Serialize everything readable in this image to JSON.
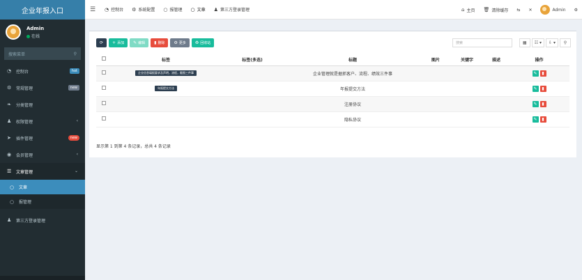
{
  "app": {
    "logo": "企业年报入口"
  },
  "user": {
    "name": "Admin",
    "status": "在线"
  },
  "sidebar": {
    "search_placeholder": "搜索菜单",
    "items": [
      {
        "label": "控制台",
        "icon": "dashboard-icon",
        "badge": "hot",
        "badge_color": "#3c8dbc"
      },
      {
        "label": "常规管理",
        "icon": "cogs-icon",
        "badge": "new",
        "badge_color": "#6e7b8b"
      },
      {
        "label": "分类管理",
        "icon": "leaf-icon"
      },
      {
        "label": "权限管理",
        "icon": "group-icon"
      },
      {
        "label": "插件管理",
        "icon": "rocket-icon",
        "badge": "new",
        "badge_color": "#e74c3c"
      },
      {
        "label": "会员管理",
        "icon": "user-circle-icon"
      },
      {
        "label": "文章管理",
        "icon": "list-icon"
      }
    ],
    "sub_items": [
      {
        "label": "文章",
        "icon": "circle-icon"
      },
      {
        "label": "报管理",
        "icon": "circle-icon"
      }
    ],
    "extra_item": {
      "label": "第三方登录管理",
      "icon": "group-icon"
    }
  },
  "topbar": {
    "tabs": [
      {
        "label": "控制台",
        "icon": "dashboard-icon"
      },
      {
        "label": "系统配置",
        "icon": "cog-icon"
      },
      {
        "label": "报管理",
        "icon": "circle-icon"
      },
      {
        "label": "文章",
        "icon": "circle-icon"
      },
      {
        "label": "第三方登录管理",
        "icon": "group-icon"
      }
    ],
    "right": {
      "home": "主页",
      "clear_cache": "清除缓存",
      "user": "Admin"
    }
  },
  "toolbar": {
    "refresh": "",
    "add": "添加",
    "edit": "编辑",
    "delete": "删除",
    "more": "更多",
    "recycle": "回收站",
    "search_placeholder": "搜索"
  },
  "table": {
    "headers": [
      "",
      "标签",
      "标签(多选)",
      "标题",
      "图片",
      "关键字",
      "描述",
      "操作"
    ],
    "rows": [
      {
        "tag": "企业信息填报要求及声明，流程，截图三件事",
        "title": "企业管理就是据抓客户、流程、绩效三件事"
      },
      {
        "tag": "年报提交方法",
        "title": "年报提交方法"
      },
      {
        "tag": "",
        "title": "注册协议"
      },
      {
        "tag": "",
        "title": "隐私协议"
      }
    ]
  },
  "footer": {
    "summary": "显示第 1 到第 4 条记录，总共 4 条记录"
  }
}
